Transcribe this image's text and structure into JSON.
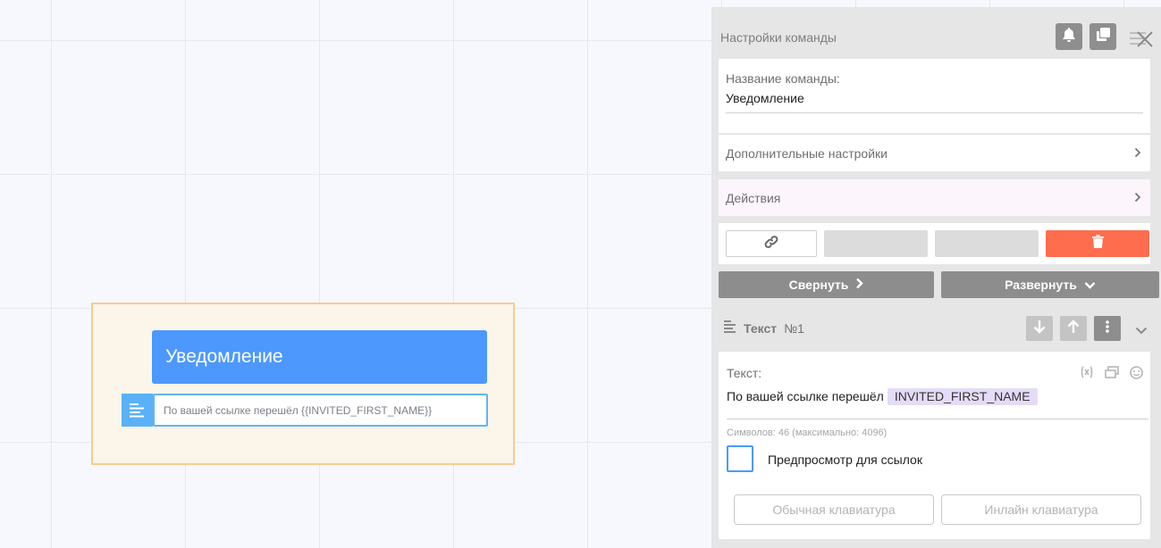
{
  "canvas": {
    "node": {
      "title": "Уведомление",
      "text_preview": "По вашей ссылке перешёл {{INVITED_FIRST_NAME}}"
    }
  },
  "panel": {
    "title": "Настройки команды",
    "name_field": {
      "label": "Название команды:",
      "value": "Уведомление"
    },
    "extra_settings": "Дополнительные настройки",
    "actions": "Действия",
    "collapse_label": "Свернуть",
    "expand_label": "Развернуть",
    "section": {
      "title": "Текст",
      "number": "№1"
    },
    "text_block": {
      "label": "Текст:",
      "text_prefix": "По вашей ссылке перешёл",
      "variable": "INVITED_FIRST_NAME",
      "char_count": "Символов: 46 (максимально: 4096)",
      "preview_checkbox_label": "Предпросмотр для ссылок",
      "keyboard_normal": "Обычная клавиатура",
      "keyboard_inline": "Инлайн клавиатура"
    }
  },
  "colors": {
    "accent": "#4d98fd",
    "danger": "#fd6d4e",
    "node_group_bg": "#fbf5ea",
    "variable_chip": "#e4dcf7"
  }
}
